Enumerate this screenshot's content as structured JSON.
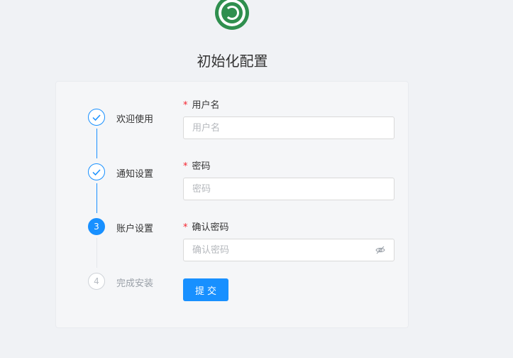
{
  "page": {
    "title": "初始化配置"
  },
  "steps": [
    {
      "number": "1",
      "label": "欢迎使用",
      "status": "done"
    },
    {
      "number": "2",
      "label": "通知设置",
      "status": "done"
    },
    {
      "number": "3",
      "label": "账户设置",
      "status": "active"
    },
    {
      "number": "4",
      "label": "完成安装",
      "status": "wait"
    }
  ],
  "form": {
    "required_mark": "*",
    "username": {
      "label": "用户名",
      "placeholder": "用户名",
      "value": ""
    },
    "password": {
      "label": "密码",
      "placeholder": "密码",
      "value": ""
    },
    "confirm_password": {
      "label": "确认密码",
      "placeholder": "确认密码",
      "value": "",
      "icon": "eye-off-icon"
    },
    "submit_label": "提交"
  },
  "colors": {
    "accent": "#1890ff",
    "required": "#f5222d",
    "logo": "#2f8f4e",
    "background": "#f0f2f5"
  }
}
